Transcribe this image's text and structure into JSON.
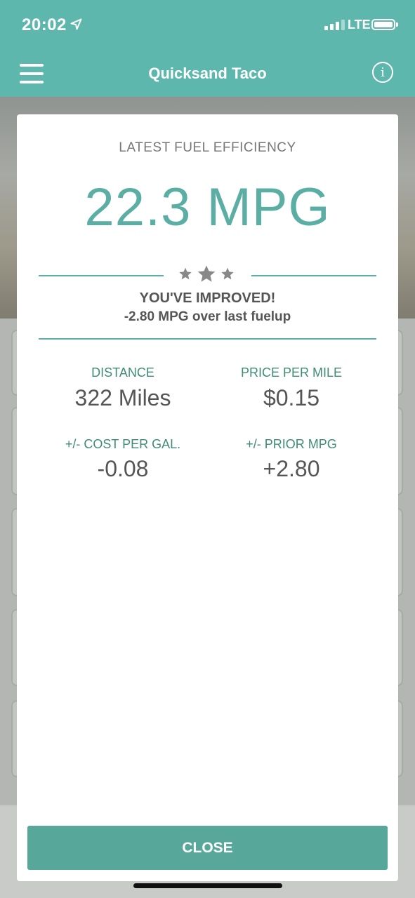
{
  "status_bar": {
    "time": "20:02",
    "network": "LTE"
  },
  "nav": {
    "title": "Quicksand Taco",
    "info_glyph": "i"
  },
  "modal": {
    "heading": "LATEST FUEL EFFICIENCY",
    "efficiency_value": "22.3 MPG",
    "improvement_title": "YOU'VE IMPROVED!",
    "improvement_detail": "-2.80 MPG over last fuelup",
    "stats": {
      "distance": {
        "label": "DISTANCE",
        "value": "322 Miles"
      },
      "price_per_mile": {
        "label": "PRICE PER MILE",
        "value": "$0.15"
      },
      "cost_per_gal": {
        "label": "+/- COST PER GAL.",
        "value": "-0.08"
      },
      "prior_mpg": {
        "label": "+/- PRIOR MPG",
        "value": "+2.80"
      }
    },
    "close_label": "CLOSE"
  },
  "colors": {
    "header": "#5db7ad",
    "accent": "#5aaea3",
    "stat_label": "#3f8c77",
    "button": "#57a79b"
  },
  "icons": [
    "location-arrow-icon",
    "signal-icon",
    "battery-icon",
    "menu-icon",
    "info-icon",
    "star-icon"
  ]
}
